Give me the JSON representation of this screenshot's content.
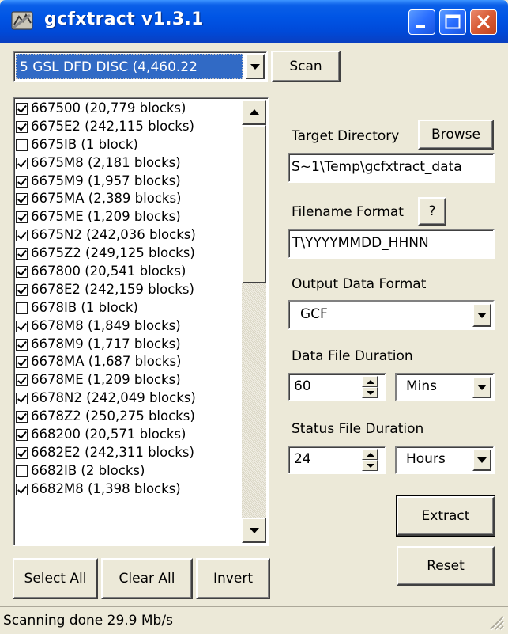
{
  "window": {
    "title": "gcfxtract  v1.3.1"
  },
  "source": {
    "selected": "5 GSL DFD DISC  (4,460.22",
    "scan_label": "Scan"
  },
  "streams": [
    {
      "label": "667500 (20,779 blocks)",
      "checked": true
    },
    {
      "label": "6675E2 (242,115 blocks)",
      "checked": true
    },
    {
      "label": "6675IB (1 block)",
      "checked": false
    },
    {
      "label": "6675M8 (2,181 blocks)",
      "checked": true
    },
    {
      "label": "6675M9 (1,957 blocks)",
      "checked": true
    },
    {
      "label": "6675MA (2,389 blocks)",
      "checked": true
    },
    {
      "label": "6675ME (1,209 blocks)",
      "checked": true
    },
    {
      "label": "6675N2 (242,036 blocks)",
      "checked": true
    },
    {
      "label": "6675Z2 (249,125 blocks)",
      "checked": true
    },
    {
      "label": "667800 (20,541 blocks)",
      "checked": true
    },
    {
      "label": "6678E2 (242,159 blocks)",
      "checked": true
    },
    {
      "label": "6678IB (1 block)",
      "checked": false
    },
    {
      "label": "6678M8 (1,849 blocks)",
      "checked": true
    },
    {
      "label": "6678M9 (1,717 blocks)",
      "checked": true
    },
    {
      "label": "6678MA (1,687 blocks)",
      "checked": true
    },
    {
      "label": "6678ME (1,209 blocks)",
      "checked": true
    },
    {
      "label": "6678N2 (242,049 blocks)",
      "checked": true
    },
    {
      "label": "6678Z2 (250,275 blocks)",
      "checked": true
    },
    {
      "label": "668200 (20,571 blocks)",
      "checked": true
    },
    {
      "label": "6682E2 (242,311 blocks)",
      "checked": true
    },
    {
      "label": "6682IB (2 blocks)",
      "checked": false
    },
    {
      "label": "6682M8 (1,398 blocks)",
      "checked": true
    }
  ],
  "list_buttons": {
    "select_all": "Select All",
    "clear_all": "Clear All",
    "invert": "Invert"
  },
  "target_directory": {
    "label": "Target Directory",
    "browse_label": "Browse",
    "value": "S~1\\Temp\\gcfxtract_data"
  },
  "filename_format": {
    "label": "Filename Format",
    "help_label": "?",
    "value": "T\\YYYYMMDD_HHNN"
  },
  "output_format": {
    "label": "Output Data Format",
    "selected": "GCF"
  },
  "data_duration": {
    "label": "Data File Duration",
    "value": "60",
    "unit": "Mins"
  },
  "status_duration": {
    "label": "Status File Duration",
    "value": "24",
    "unit": "Hours"
  },
  "actions": {
    "extract": "Extract",
    "reset": "Reset"
  },
  "status": {
    "text": "Scanning done 29.9 Mb/s"
  },
  "colors": {
    "title_bar": "#0055e5",
    "selection": "#316ac5",
    "window_bg": "#ece9d8"
  }
}
